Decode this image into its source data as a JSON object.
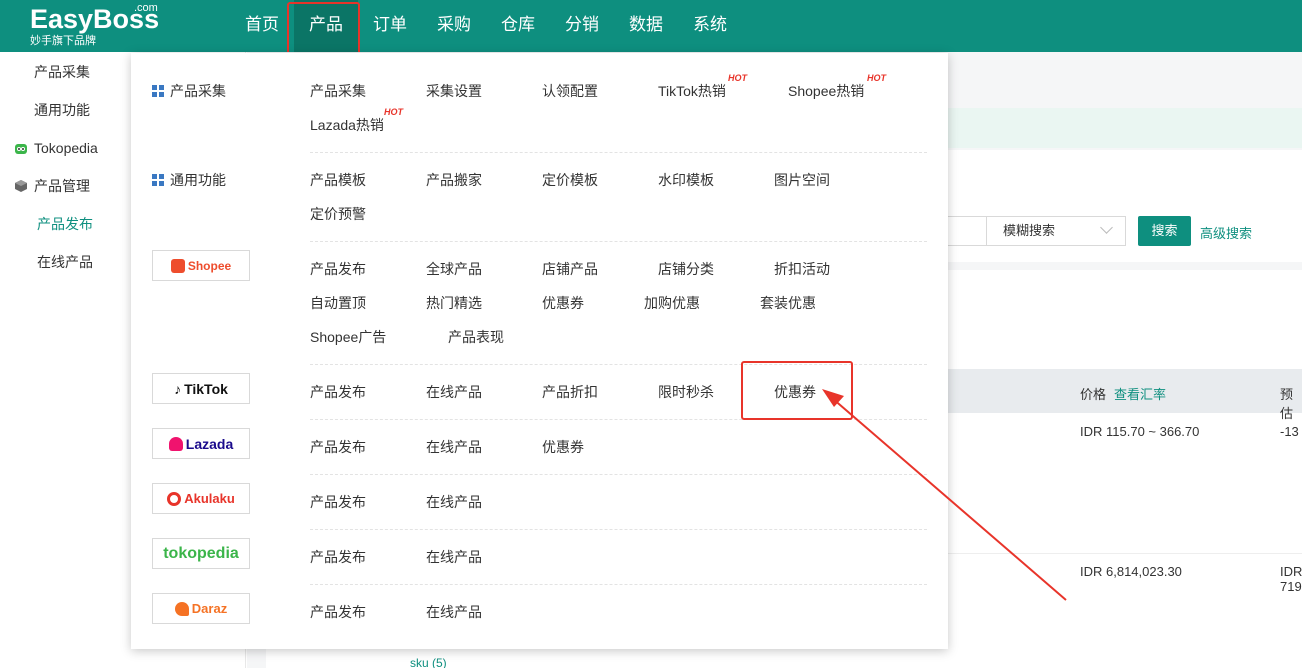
{
  "header": {
    "logo_text": "EasyBoss",
    "logo_com": ".com",
    "logo_sub": "妙手旗下品牌",
    "nav": [
      "首页",
      "产品",
      "订单",
      "采购",
      "仓库",
      "分销",
      "数据",
      "系统"
    ]
  },
  "sidebar": {
    "items": [
      "产品采集",
      "通用功能",
      "Tokopedia",
      "产品管理"
    ],
    "subitems": [
      "产品发布",
      "在线产品"
    ]
  },
  "background": {
    "search_mode": "模糊搜索",
    "search_button": "搜索",
    "advanced_search": "高级搜索",
    "price_header": "价格",
    "exchange_rate": "查看汇率",
    "estimate_header": "预估",
    "row1_price": "IDR 115.70 ~ 366.70",
    "row1_est": "-13",
    "row2_price": "IDR 6,814,023.30",
    "row2_est_a": "IDR",
    "row2_est_b": "719",
    "sku": "sku (5)"
  },
  "menu": {
    "collect": {
      "title": "产品采集",
      "links": [
        "产品采集",
        "采集设置",
        "认领配置",
        "TikTok热销",
        "Shopee热销",
        "Lazada热销"
      ],
      "hot": "HOT"
    },
    "general": {
      "title": "通用功能",
      "links": [
        "产品模板",
        "产品搬家",
        "定价模板",
        "水印模板",
        "图片空间",
        "定价预警"
      ]
    },
    "shopee": {
      "logo": "Shopee",
      "links": [
        "产品发布",
        "全球产品",
        "店铺产品",
        "店铺分类",
        "折扣活动",
        "自动置顶",
        "热门精选",
        "优惠券",
        "加购优惠",
        "套装优惠",
        "Shopee广告",
        "产品表现"
      ]
    },
    "tiktok": {
      "logo": "TikTok",
      "links": [
        "产品发布",
        "在线产品",
        "产品折扣",
        "限时秒杀",
        "优惠券"
      ]
    },
    "lazada": {
      "logo": "Lazada",
      "links": [
        "产品发布",
        "在线产品",
        "优惠券"
      ]
    },
    "akulaku": {
      "logo": "Akulaku",
      "links": [
        "产品发布",
        "在线产品"
      ]
    },
    "tokopedia": {
      "logo": "tokopedia",
      "links": [
        "产品发布",
        "在线产品"
      ]
    },
    "daraz": {
      "logo": "Daraz",
      "links": [
        "产品发布",
        "在线产品"
      ]
    }
  },
  "colors": {
    "brand": "#0e8f7f",
    "highlight": "#e8342a"
  }
}
